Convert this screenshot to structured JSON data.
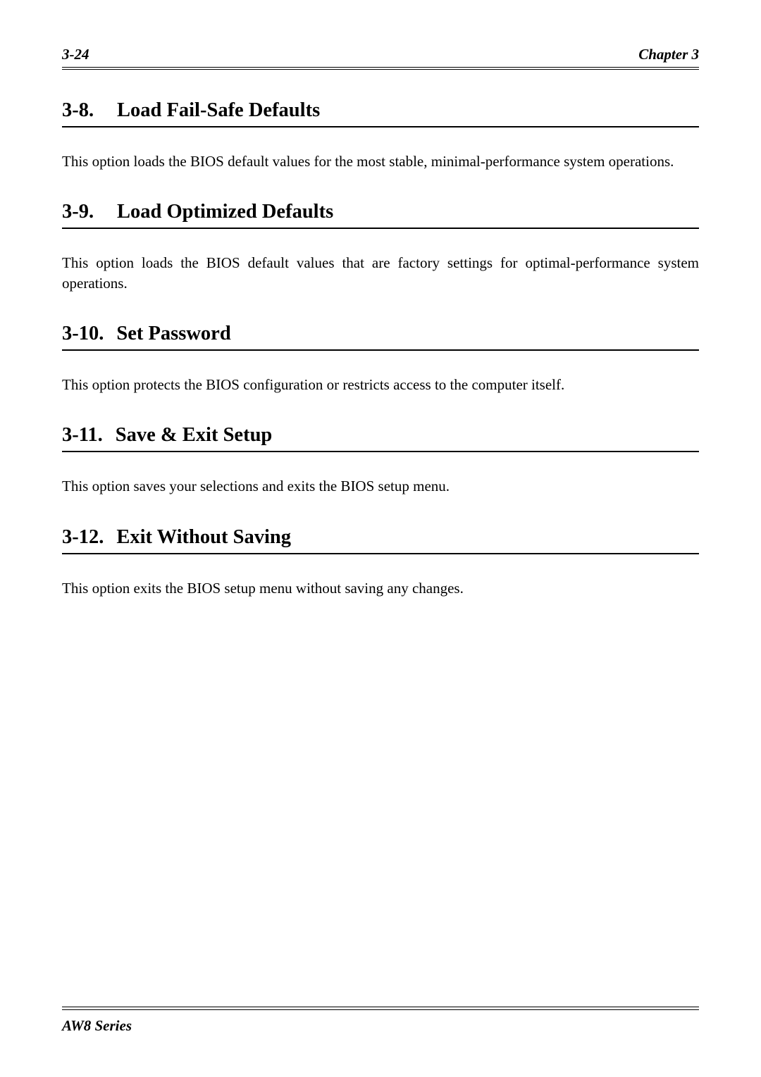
{
  "header": {
    "page_number": "3-24",
    "chapter": "Chapter 3"
  },
  "sections": [
    {
      "number": "3-8.",
      "title": "Load Fail-Safe Defaults",
      "body": "This option loads the BIOS default values for the most stable, minimal-performance system operations.",
      "justify": false
    },
    {
      "number": "3-9.",
      "title": "Load Optimized Defaults",
      "body": "This option loads the BIOS default values that are factory settings for optimal-performance system operations.",
      "justify": true
    },
    {
      "number": "3-10.",
      "title": "Set Password",
      "body": "This option protects the BIOS configuration or restricts access to the computer itself.",
      "justify": false
    },
    {
      "number": "3-11.",
      "title": "Save & Exit Setup",
      "body": "This option saves your selections and exits the BIOS setup menu.",
      "justify": false
    },
    {
      "number": "3-12.",
      "title": "Exit Without Saving",
      "body": "This option exits the BIOS setup menu without saving any changes.",
      "justify": false
    }
  ],
  "footer": {
    "series": "AW8 Series"
  }
}
